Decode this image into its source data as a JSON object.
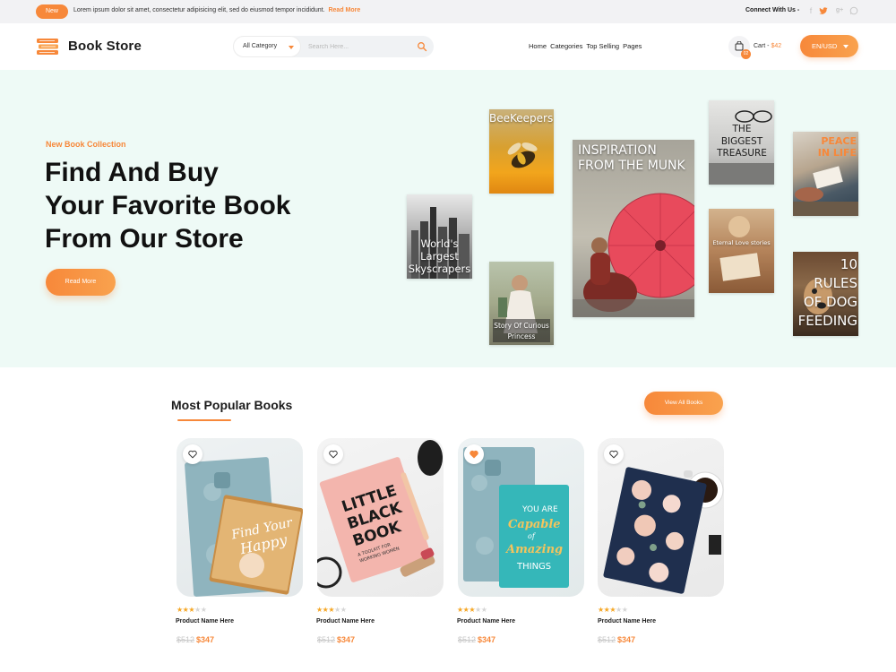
{
  "topbar": {
    "badge": "New",
    "notice": "Lorem ipsum dolor sit amet, consectetur adipisicing elit, sed do eiusmod tempor incididunt.",
    "read_more": "Read More",
    "connect": "Connect With Us -",
    "social_icons": [
      "facebook-icon",
      "twitter-icon",
      "google-plus-icon",
      "whatsapp-icon"
    ]
  },
  "header": {
    "logo": "Book Store",
    "category_select": "All Category",
    "search_placeholder": "Search Here...",
    "nav": [
      "Home",
      "Categories",
      "Top Selling",
      "Pages"
    ],
    "cart_count": "02",
    "cart_label": "Cart -",
    "cart_amount": "$42",
    "currency": "EN/USD"
  },
  "hero": {
    "subtitle": "New Book Collection",
    "title_lines": [
      "Find And Buy",
      "Your Favorite Book",
      "From Our Store"
    ],
    "button": "Read More",
    "books": [
      {
        "title": "BeeKeepers"
      },
      {
        "title": "INSPIRATION FROM THE MUNK"
      },
      {
        "title": "THE BIGGEST TREASURE"
      },
      {
        "title": "PEACE IN LIFE"
      },
      {
        "title": "World's Largest Skyscrapers"
      },
      {
        "title": "Story Of Curious Princess"
      },
      {
        "title": "Eternal Love stories"
      },
      {
        "title": "10 RULES OF DOG FEEDING"
      }
    ]
  },
  "popular": {
    "title": "Most Popular Books",
    "view_all": "View All Books",
    "products": [
      {
        "name": "Product Name Here",
        "old_price": "$512",
        "price": "$347",
        "rating": 3,
        "favorited": false
      },
      {
        "name": "Product Name Here",
        "old_price": "$512",
        "price": "$347",
        "rating": 3,
        "favorited": false
      },
      {
        "name": "Product Name Here",
        "old_price": "$512",
        "price": "$347",
        "rating": 3,
        "favorited": true
      },
      {
        "name": "Product Name Here",
        "old_price": "$512",
        "price": "$347",
        "rating": 3,
        "favorited": false
      }
    ],
    "card_book_texts": [
      "Find Your Happy",
      "LITTLE BLACK BOOK",
      "A TOOLKIT FOR WORKING WOMEN",
      "YOU ARE Capable of Amazing THINGS"
    ]
  },
  "colors": {
    "accent": "#f7883a",
    "hero_bg": "#eefaf6",
    "topbar_bg": "#f2f2f4",
    "star": "#f5a623"
  }
}
